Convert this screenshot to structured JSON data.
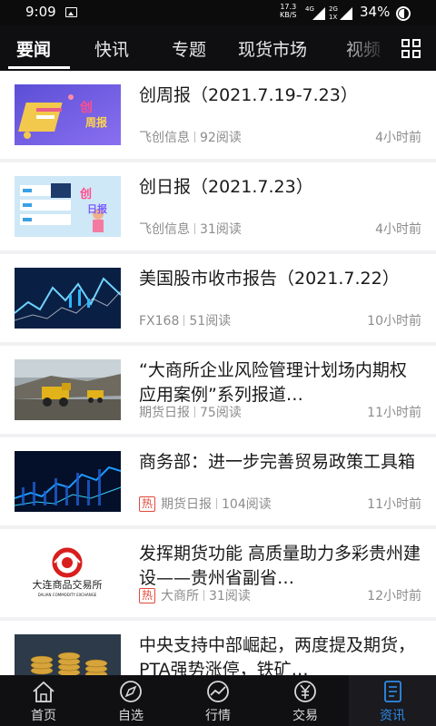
{
  "status_bar": {
    "time": "9:09",
    "speed_value": "17.3",
    "speed_unit": "KB/S",
    "net_top": "4G",
    "net_bottom": "2G",
    "net_slot": "1X",
    "battery_percent": "34%"
  },
  "tabs": [
    {
      "label": "要闻",
      "active": true
    },
    {
      "label": "快讯",
      "active": false
    },
    {
      "label": "专题",
      "active": false
    },
    {
      "label": "现货市场",
      "active": false
    },
    {
      "label": "视频",
      "active": false
    }
  ],
  "articles": [
    {
      "title": "创周报（2021.7.19-7.23）",
      "source": "飞创信息",
      "reads": "92阅读",
      "time": "4小时前",
      "hot": false,
      "thumb": "weekly-report-illustration"
    },
    {
      "title": "创日报（2021.7.23）",
      "source": "飞创信息",
      "reads": "31阅读",
      "time": "4小时前",
      "hot": false,
      "thumb": "daily-report-illustration"
    },
    {
      "title": "美国股市收市报告（2021.7.22）",
      "source": "FX168",
      "reads": "51阅读",
      "time": "10小时前",
      "hot": false,
      "thumb": "stock-chart-image"
    },
    {
      "title": "“大商所企业风险管理计划场内期权应用案例”系列报道…",
      "source": "期货日报",
      "reads": "75阅读",
      "time": "11小时前",
      "hot": false,
      "thumb": "mining-trucks-image"
    },
    {
      "title": "商务部：进一步完善贸易政策工具箱",
      "source": "期货日报",
      "reads": "104阅读",
      "time": "11小时前",
      "hot": true,
      "hot_label": "热",
      "thumb": "blue-market-image"
    },
    {
      "title": "发挥期货功能 高质量助力多彩贵州建设——贵州省副省…",
      "source": "大商所",
      "reads": "31阅读",
      "time": "12小时前",
      "hot": true,
      "hot_label": "热",
      "thumb": "dce-logo-image",
      "logo_text_cn": "大连商品交易所",
      "logo_text_en": "DALIAN COMMODITY EXCHANGE"
    },
    {
      "title": "中央支持中部崛起，两度提及期货，PTA强势涨停，铁矿…",
      "source": "",
      "reads": "",
      "time": "",
      "hot": false,
      "thumb": "coins-image"
    }
  ],
  "thumb_text": {
    "weekly_badge": "创",
    "weekly_word": "周报",
    "daily_badge": "创",
    "daily_word": "日报"
  },
  "bottom_nav": [
    {
      "label": "首页",
      "icon": "home-icon",
      "active": false
    },
    {
      "label": "自选",
      "icon": "compass-icon",
      "active": false
    },
    {
      "label": "行情",
      "icon": "trend-icon",
      "active": false
    },
    {
      "label": "交易",
      "icon": "yuan-icon",
      "active": false
    },
    {
      "label": "资讯",
      "icon": "news-icon",
      "active": true
    }
  ],
  "colors": {
    "accent_blue": "#2f8be8",
    "hot_red": "#e2493b",
    "bar_dark": "#0f0f12"
  }
}
